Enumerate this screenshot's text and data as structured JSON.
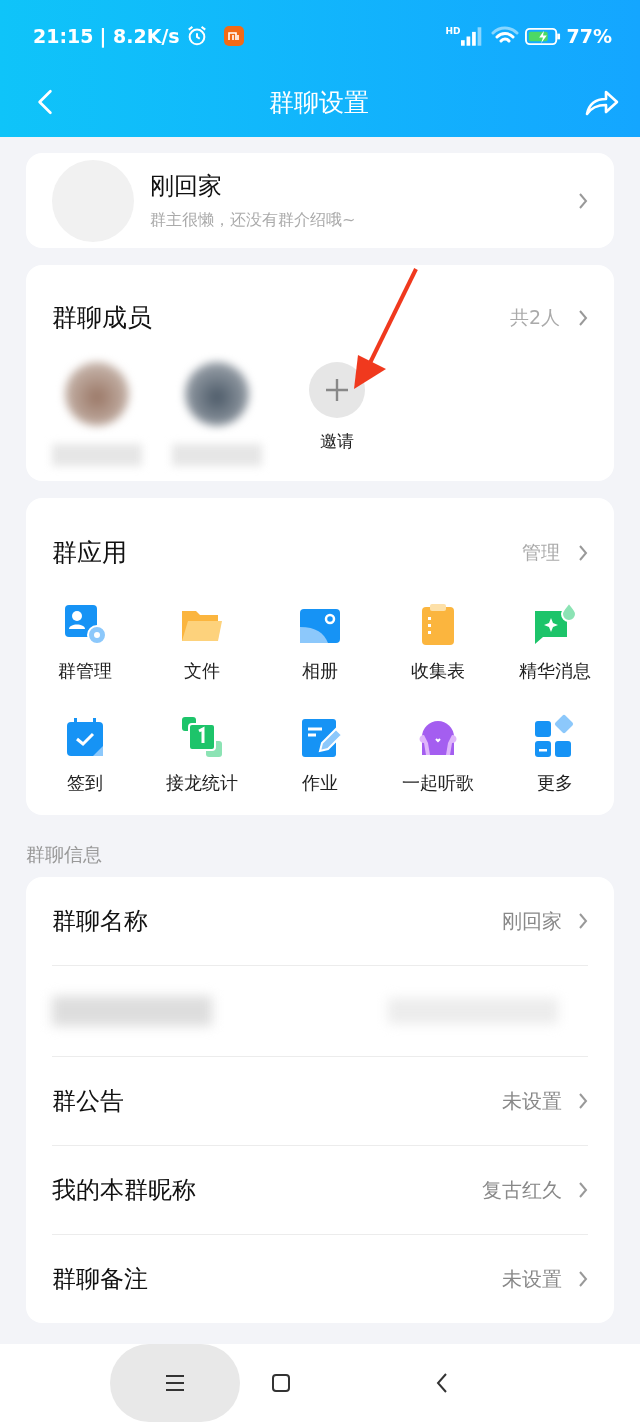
{
  "status_bar": {
    "time": "21:15",
    "speed": "| 8.2K/s",
    "network": "HD",
    "battery": "77%"
  },
  "header": {
    "title": "群聊设置"
  },
  "group": {
    "name": "刚回家",
    "intro": "群主很懒，还没有群介绍哦~"
  },
  "members": {
    "title": "群聊成员",
    "count": "共2人",
    "invite": "邀请"
  },
  "apps": {
    "title": "群应用",
    "manage": "管理",
    "items": [
      {
        "label": "群管理"
      },
      {
        "label": "文件"
      },
      {
        "label": "相册"
      },
      {
        "label": "收集表"
      },
      {
        "label": "精华消息"
      },
      {
        "label": "签到"
      },
      {
        "label": "接龙统计"
      },
      {
        "label": "作业"
      },
      {
        "label": "一起听歌"
      },
      {
        "label": "更多"
      }
    ]
  },
  "info": {
    "section": "群聊信息",
    "rows": [
      {
        "kind": "normal",
        "label": "群聊名称",
        "value": "刚回家"
      },
      {
        "kind": "redacted"
      },
      {
        "kind": "normal",
        "label": "群公告",
        "value": "未设置"
      },
      {
        "kind": "normal",
        "label": "我的本群昵称",
        "value": "复古红久"
      },
      {
        "kind": "normal",
        "label": "群聊备注",
        "value": "未设置"
      }
    ]
  },
  "nav": [
    {
      "selected": true
    },
    {
      "selected": false
    },
    {
      "selected": false
    }
  ]
}
